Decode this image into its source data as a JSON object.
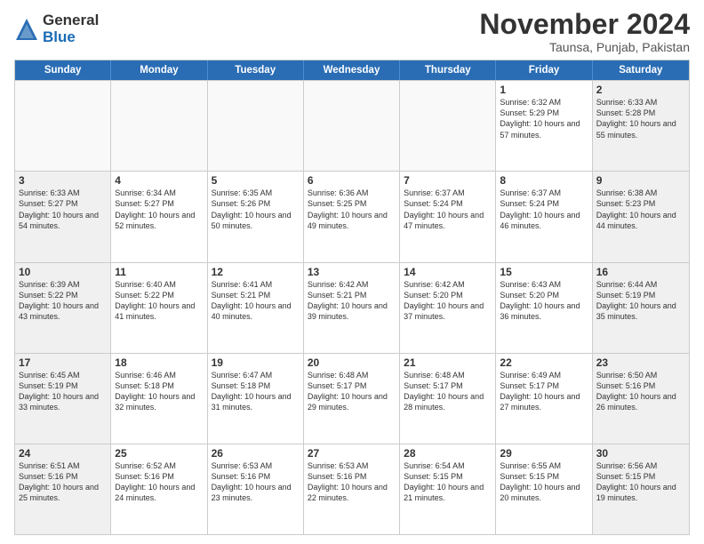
{
  "logo": {
    "general": "General",
    "blue": "Blue"
  },
  "header": {
    "month": "November 2024",
    "location": "Taunsa, Punjab, Pakistan"
  },
  "weekdays": [
    "Sunday",
    "Monday",
    "Tuesday",
    "Wednesday",
    "Thursday",
    "Friday",
    "Saturday"
  ],
  "rows": [
    [
      {
        "day": "",
        "detail": "",
        "empty": true
      },
      {
        "day": "",
        "detail": "",
        "empty": true
      },
      {
        "day": "",
        "detail": "",
        "empty": true
      },
      {
        "day": "",
        "detail": "",
        "empty": true
      },
      {
        "day": "",
        "detail": "",
        "empty": true
      },
      {
        "day": "1",
        "detail": "Sunrise: 6:32 AM\nSunset: 5:29 PM\nDaylight: 10 hours and 57 minutes.",
        "empty": false
      },
      {
        "day": "2",
        "detail": "Sunrise: 6:33 AM\nSunset: 5:28 PM\nDaylight: 10 hours and 55 minutes.",
        "empty": false
      }
    ],
    [
      {
        "day": "3",
        "detail": "Sunrise: 6:33 AM\nSunset: 5:27 PM\nDaylight: 10 hours and 54 minutes.",
        "empty": false
      },
      {
        "day": "4",
        "detail": "Sunrise: 6:34 AM\nSunset: 5:27 PM\nDaylight: 10 hours and 52 minutes.",
        "empty": false
      },
      {
        "day": "5",
        "detail": "Sunrise: 6:35 AM\nSunset: 5:26 PM\nDaylight: 10 hours and 50 minutes.",
        "empty": false
      },
      {
        "day": "6",
        "detail": "Sunrise: 6:36 AM\nSunset: 5:25 PM\nDaylight: 10 hours and 49 minutes.",
        "empty": false
      },
      {
        "day": "7",
        "detail": "Sunrise: 6:37 AM\nSunset: 5:24 PM\nDaylight: 10 hours and 47 minutes.",
        "empty": false
      },
      {
        "day": "8",
        "detail": "Sunrise: 6:37 AM\nSunset: 5:24 PM\nDaylight: 10 hours and 46 minutes.",
        "empty": false
      },
      {
        "day": "9",
        "detail": "Sunrise: 6:38 AM\nSunset: 5:23 PM\nDaylight: 10 hours and 44 minutes.",
        "empty": false
      }
    ],
    [
      {
        "day": "10",
        "detail": "Sunrise: 6:39 AM\nSunset: 5:22 PM\nDaylight: 10 hours and 43 minutes.",
        "empty": false
      },
      {
        "day": "11",
        "detail": "Sunrise: 6:40 AM\nSunset: 5:22 PM\nDaylight: 10 hours and 41 minutes.",
        "empty": false
      },
      {
        "day": "12",
        "detail": "Sunrise: 6:41 AM\nSunset: 5:21 PM\nDaylight: 10 hours and 40 minutes.",
        "empty": false
      },
      {
        "day": "13",
        "detail": "Sunrise: 6:42 AM\nSunset: 5:21 PM\nDaylight: 10 hours and 39 minutes.",
        "empty": false
      },
      {
        "day": "14",
        "detail": "Sunrise: 6:42 AM\nSunset: 5:20 PM\nDaylight: 10 hours and 37 minutes.",
        "empty": false
      },
      {
        "day": "15",
        "detail": "Sunrise: 6:43 AM\nSunset: 5:20 PM\nDaylight: 10 hours and 36 minutes.",
        "empty": false
      },
      {
        "day": "16",
        "detail": "Sunrise: 6:44 AM\nSunset: 5:19 PM\nDaylight: 10 hours and 35 minutes.",
        "empty": false
      }
    ],
    [
      {
        "day": "17",
        "detail": "Sunrise: 6:45 AM\nSunset: 5:19 PM\nDaylight: 10 hours and 33 minutes.",
        "empty": false
      },
      {
        "day": "18",
        "detail": "Sunrise: 6:46 AM\nSunset: 5:18 PM\nDaylight: 10 hours and 32 minutes.",
        "empty": false
      },
      {
        "day": "19",
        "detail": "Sunrise: 6:47 AM\nSunset: 5:18 PM\nDaylight: 10 hours and 31 minutes.",
        "empty": false
      },
      {
        "day": "20",
        "detail": "Sunrise: 6:48 AM\nSunset: 5:17 PM\nDaylight: 10 hours and 29 minutes.",
        "empty": false
      },
      {
        "day": "21",
        "detail": "Sunrise: 6:48 AM\nSunset: 5:17 PM\nDaylight: 10 hours and 28 minutes.",
        "empty": false
      },
      {
        "day": "22",
        "detail": "Sunrise: 6:49 AM\nSunset: 5:17 PM\nDaylight: 10 hours and 27 minutes.",
        "empty": false
      },
      {
        "day": "23",
        "detail": "Sunrise: 6:50 AM\nSunset: 5:16 PM\nDaylight: 10 hours and 26 minutes.",
        "empty": false
      }
    ],
    [
      {
        "day": "24",
        "detail": "Sunrise: 6:51 AM\nSunset: 5:16 PM\nDaylight: 10 hours and 25 minutes.",
        "empty": false
      },
      {
        "day": "25",
        "detail": "Sunrise: 6:52 AM\nSunset: 5:16 PM\nDaylight: 10 hours and 24 minutes.",
        "empty": false
      },
      {
        "day": "26",
        "detail": "Sunrise: 6:53 AM\nSunset: 5:16 PM\nDaylight: 10 hours and 23 minutes.",
        "empty": false
      },
      {
        "day": "27",
        "detail": "Sunrise: 6:53 AM\nSunset: 5:16 PM\nDaylight: 10 hours and 22 minutes.",
        "empty": false
      },
      {
        "day": "28",
        "detail": "Sunrise: 6:54 AM\nSunset: 5:15 PM\nDaylight: 10 hours and 21 minutes.",
        "empty": false
      },
      {
        "day": "29",
        "detail": "Sunrise: 6:55 AM\nSunset: 5:15 PM\nDaylight: 10 hours and 20 minutes.",
        "empty": false
      },
      {
        "day": "30",
        "detail": "Sunrise: 6:56 AM\nSunset: 5:15 PM\nDaylight: 10 hours and 19 minutes.",
        "empty": false
      }
    ]
  ]
}
